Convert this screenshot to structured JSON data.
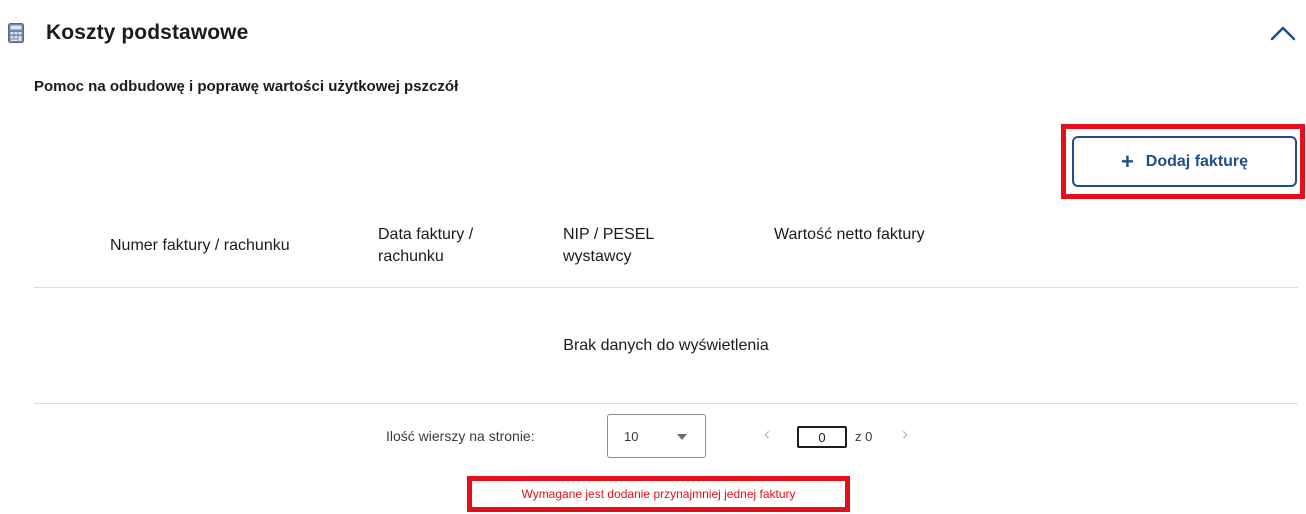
{
  "section": {
    "title": "Koszty podstawowe",
    "subtitle": "Pomoc na odbudowę i poprawę wartości użytkowej pszczół",
    "icon": "calculator-icon"
  },
  "actions": {
    "add_invoice_label": "Dodaj fakturę",
    "add_icon": "plus-icon"
  },
  "table": {
    "columns": [
      "Numer faktury / rachunku",
      "Data faktury / rachunku",
      "NIP / PESEL wystawcy",
      "Wartość netto faktury"
    ],
    "empty_message": "Brak danych do wyświetlenia"
  },
  "pagination": {
    "rows_label": "Ilość wierszy na stronie:",
    "rows_value": "10",
    "page_value": "0",
    "page_total": "z 0",
    "prev_symbol": "‹",
    "next_symbol": "›"
  },
  "validation": {
    "error": "Wymagane jest dodanie przynajmniej jednej faktury"
  },
  "colors": {
    "primary": "#1f4e8c",
    "error": "#e3101c",
    "text": "#1b1b1b",
    "divider": "#d9dde3"
  }
}
